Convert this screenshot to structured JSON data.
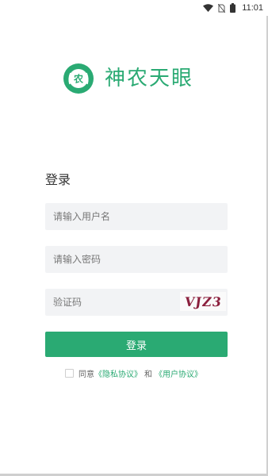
{
  "status_bar": {
    "time": "11:01",
    "icons": [
      "wifi-icon",
      "sim-no-signal-icon",
      "battery-icon"
    ]
  },
  "brand": {
    "name": "神农天眼",
    "logo_text": "农",
    "color": "#2aaa73"
  },
  "login": {
    "title": "登录",
    "username_placeholder": "请输入用户名",
    "password_placeholder": "请输入密码",
    "captcha_placeholder": "验证码",
    "captcha_text": "VJZ3",
    "button_label": "登录"
  },
  "agreement": {
    "prefix": "同意",
    "privacy_link": "《隐私协议》",
    "conjunction": "和",
    "user_link": "《用户协议》"
  }
}
